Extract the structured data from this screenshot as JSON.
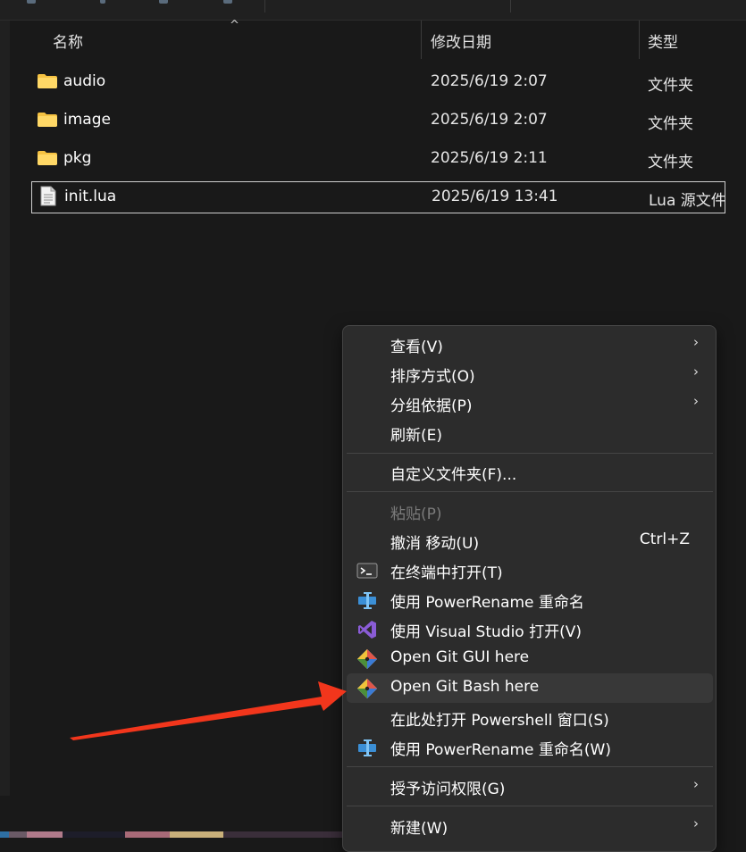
{
  "columns": {
    "name": "名称",
    "modified": "修改日期",
    "type": "类型"
  },
  "files": [
    {
      "name": "audio",
      "modified": "2025/6/19 2:07",
      "type": "文件夹",
      "icon": "folder-icon"
    },
    {
      "name": "image",
      "modified": "2025/6/19 2:07",
      "type": "文件夹",
      "icon": "folder-icon"
    },
    {
      "name": "pkg",
      "modified": "2025/6/19 2:11",
      "type": "文件夹",
      "icon": "folder-icon"
    },
    {
      "name": "init.lua",
      "modified": "2025/6/19 13:41",
      "type": "Lua 源文件",
      "icon": "file-icon",
      "selected": true
    }
  ],
  "context_menu": {
    "view": "查看(V)",
    "sort": "排序方式(O)",
    "group": "分组依据(P)",
    "refresh": "刷新(E)",
    "customize": "自定义文件夹(F)...",
    "paste": "粘贴(P)",
    "undo": "撤消 移动(U)",
    "undo_shortcut": "Ctrl+Z",
    "terminal": "在终端中打开(T)",
    "powerrename1": "使用 PowerRename 重命名",
    "visual_studio": "使用 Visual Studio 打开(V)",
    "git_gui": "Open Git GUI here",
    "git_bash": "Open Git Bash here",
    "powershell": "在此处打开 Powershell 窗口(S)",
    "powerrename2": "使用 PowerRename 重命名(W)",
    "grant_access": "授予访问权限(G)",
    "new": "新建(W)",
    "submenu_arrow": "›"
  },
  "colors": {
    "folder": "#f5c242",
    "annotation_arrow": "#f2361c",
    "menu_bg": "#2c2c2c",
    "background": "#191919"
  }
}
